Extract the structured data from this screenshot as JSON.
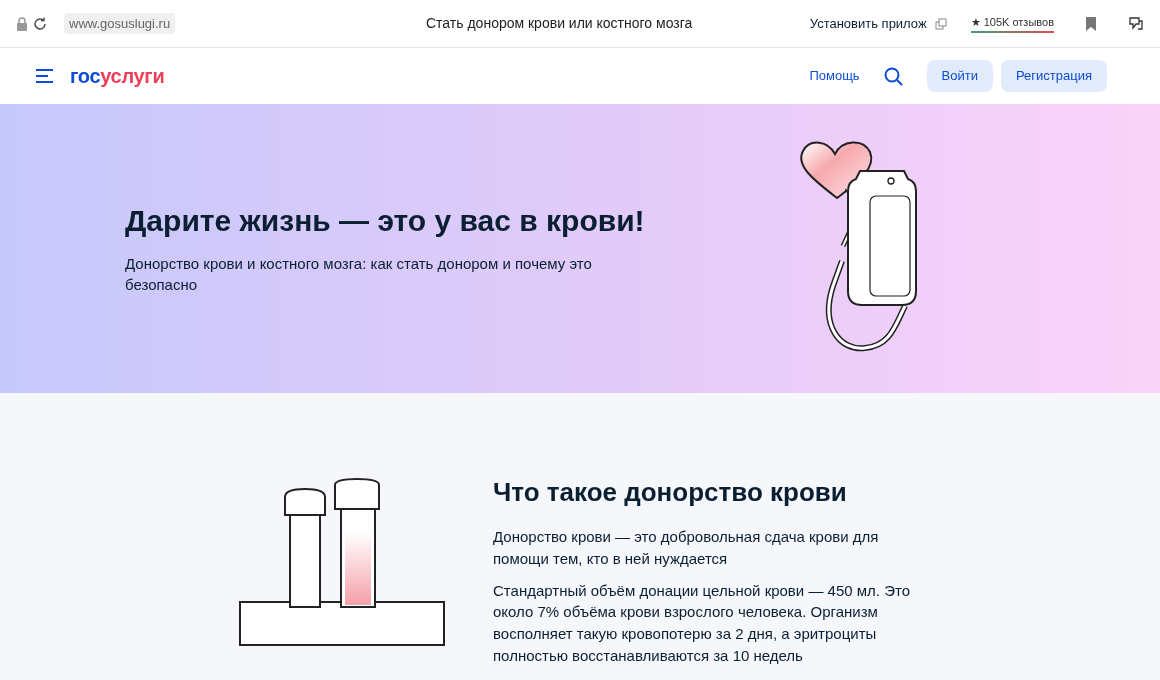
{
  "browser": {
    "url": "www.gosuslugi.ru",
    "page_title": "Стать донором крови или костного мозга",
    "install_label": "Установить прилож",
    "rating_star": "★",
    "rating_label": "105K отзывов"
  },
  "header": {
    "logo_prefix": "гос",
    "logo_suffix": "услуги",
    "help_link": "Помощь",
    "buttons": [
      "Войти",
      "Регистрация"
    ]
  },
  "hero": {
    "title": "Дарите жизнь — это у вас в крови!",
    "subtitle": "Донорство крови и костного мозга: как стать донором и почему это безопасно"
  },
  "section": {
    "title": "Что такое донорство крови",
    "paragraphs": [
      "Донорство крови — это добровольная сдача крови для помощи тем, кто в ней нуждается",
      "Стандартный объём донации цельной крови — 450 мл. Это около 7% объёма крови взрослого человека. Организм восполняет такую кровопотерю за 2 дня, а эритроциты полностью восстанавливаются за 10 недель"
    ]
  }
}
